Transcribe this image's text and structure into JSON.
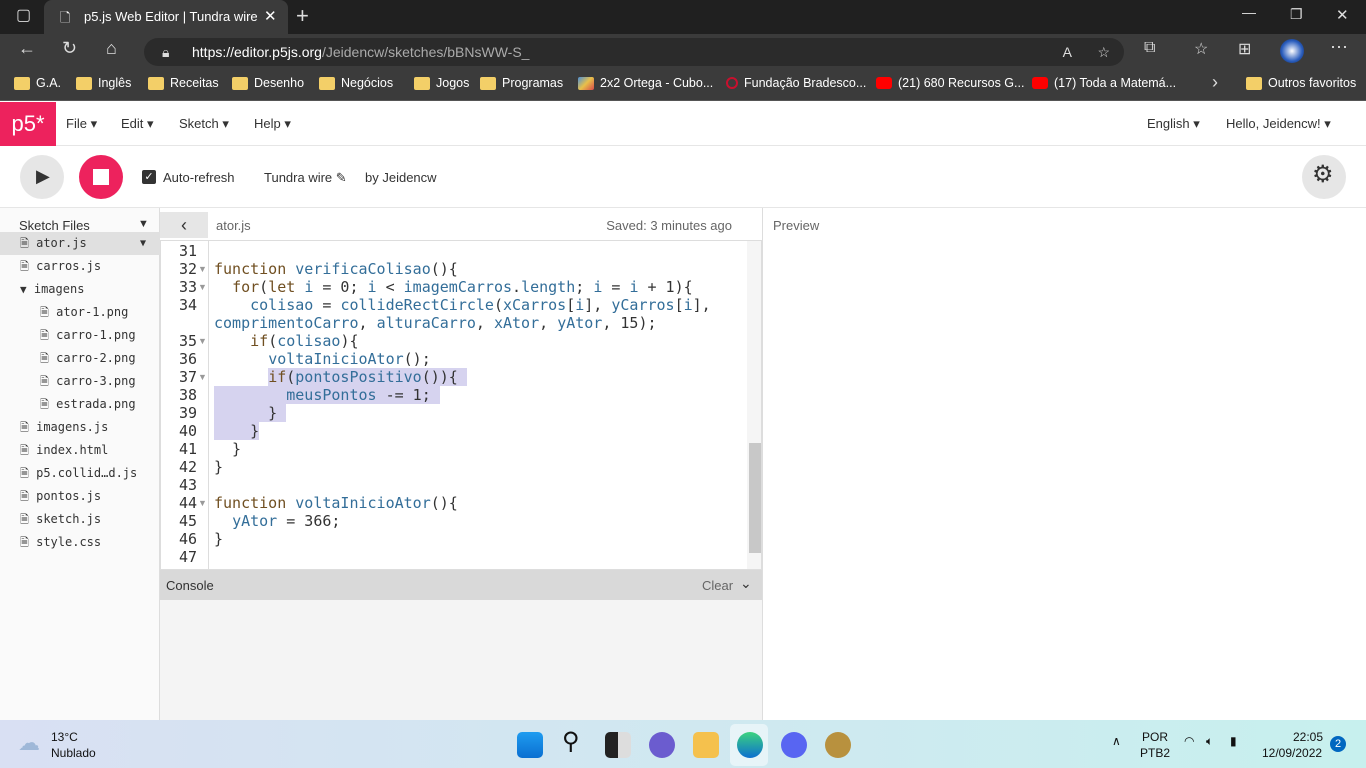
{
  "browser": {
    "tab_title": "p5.js Web Editor | Tundra wire",
    "url_host": "https://editor.p5js.org",
    "url_path": "/Jeidencw/sketches/bBNsWW-S_",
    "bookmarks": [
      {
        "label": "G.A.",
        "icon": "folder"
      },
      {
        "label": "Inglês",
        "icon": "folder"
      },
      {
        "label": "Receitas",
        "icon": "folder"
      },
      {
        "label": "Desenho",
        "icon": "folder"
      },
      {
        "label": "Negócios",
        "icon": "folder"
      },
      {
        "label": "Jogos",
        "icon": "folder"
      },
      {
        "label": "Programas",
        "icon": "folder"
      },
      {
        "label": "2x2 Ortega - Cubo...",
        "icon": "cube"
      },
      {
        "label": "Fundação Bradesco...",
        "icon": "bradesco"
      },
      {
        "label": "(21) 680 Recursos G...",
        "icon": "youtube"
      },
      {
        "label": "(17) Toda a Matemá...",
        "icon": "youtube"
      }
    ],
    "other_favorites": "Outros favoritos"
  },
  "app": {
    "logo": "p5*",
    "menus": [
      "File",
      "Edit",
      "Sketch",
      "Help"
    ],
    "language": "English",
    "user": "Hello, Jeidencw!",
    "auto_refresh_label": "Auto-refresh",
    "auto_refresh": true,
    "sketch_name": "Tundra wire",
    "by": "by Jeidencw",
    "accent": "#ed225d"
  },
  "sidebar": {
    "title": "Sketch Files",
    "files": [
      {
        "name": "ator.js",
        "level": 0,
        "type": "file",
        "selected": true
      },
      {
        "name": "carros.js",
        "level": 0,
        "type": "file"
      },
      {
        "name": "imagens",
        "level": 0,
        "type": "folder"
      },
      {
        "name": "ator-1.png",
        "level": 1,
        "type": "file"
      },
      {
        "name": "carro-1.png",
        "level": 1,
        "type": "file"
      },
      {
        "name": "carro-2.png",
        "level": 1,
        "type": "file"
      },
      {
        "name": "carro-3.png",
        "level": 1,
        "type": "file"
      },
      {
        "name": "estrada.png",
        "level": 1,
        "type": "file"
      },
      {
        "name": "imagens.js",
        "level": 0,
        "type": "file"
      },
      {
        "name": "index.html",
        "level": 0,
        "type": "file"
      },
      {
        "name": "p5.collid…d.js",
        "level": 0,
        "type": "file"
      },
      {
        "name": "pontos.js",
        "level": 0,
        "type": "file"
      },
      {
        "name": "sketch.js",
        "level": 0,
        "type": "file"
      },
      {
        "name": "style.css",
        "level": 0,
        "type": "file"
      }
    ]
  },
  "editor": {
    "filename": "ator.js",
    "saved": "Saved: 3 minutes ago",
    "preview_label": "Preview",
    "lines": [
      {
        "n": "31",
        "t": []
      },
      {
        "n": "32",
        "f": 1,
        "t": [
          [
            "kw",
            "function "
          ],
          [
            "id",
            "verificaColisao"
          ],
          [
            "pl",
            "(){"
          ]
        ]
      },
      {
        "n": "33",
        "f": 1,
        "t": [
          [
            "pl",
            "  "
          ],
          [
            "kw",
            "for"
          ],
          [
            "pl",
            "("
          ],
          [
            "kw",
            "let "
          ],
          [
            "id",
            "i"
          ],
          [
            "pl",
            " = 0; "
          ],
          [
            "id",
            "i"
          ],
          [
            "pl",
            " < "
          ],
          [
            "id",
            "imagemCarros"
          ],
          [
            "pl",
            "."
          ],
          [
            "id",
            "length"
          ],
          [
            "pl",
            "; "
          ],
          [
            "id",
            "i"
          ],
          [
            "pl",
            " = "
          ],
          [
            "id",
            "i"
          ],
          [
            "pl",
            " + 1){"
          ]
        ]
      },
      {
        "n": "34",
        "t": [
          [
            "pl",
            "    "
          ],
          [
            "id",
            "colisao"
          ],
          [
            "pl",
            " = "
          ],
          [
            "id",
            "collideRectCircle"
          ],
          [
            "pl",
            "("
          ],
          [
            "id",
            "xCarros"
          ],
          [
            "pl",
            "["
          ],
          [
            "id",
            "i"
          ],
          [
            "pl",
            "], "
          ],
          [
            "id",
            "yCarros"
          ],
          [
            "pl",
            "["
          ],
          [
            "id",
            "i"
          ],
          [
            "pl",
            "],"
          ]
        ]
      },
      {
        "n": "",
        "t": [
          [
            "id",
            "comprimentoCarro"
          ],
          [
            "pl",
            ", "
          ],
          [
            "id",
            "alturaCarro"
          ],
          [
            "pl",
            ", "
          ],
          [
            "id",
            "xAtor"
          ],
          [
            "pl",
            ", "
          ],
          [
            "id",
            "yAtor"
          ],
          [
            "pl",
            ", 15);"
          ]
        ]
      },
      {
        "n": "35",
        "f": 1,
        "t": [
          [
            "pl",
            "    "
          ],
          [
            "kw",
            "if"
          ],
          [
            "pl",
            "("
          ],
          [
            "id",
            "colisao"
          ],
          [
            "pl",
            "){"
          ]
        ]
      },
      {
        "n": "36",
        "t": [
          [
            "pl",
            "      "
          ],
          [
            "id",
            "voltaInicioAtor"
          ],
          [
            "pl",
            "();"
          ]
        ]
      },
      {
        "n": "37",
        "f": 1,
        "t": [
          [
            "pl",
            "      "
          ],
          [
            "kw sel",
            "if"
          ],
          [
            "pl sel",
            "("
          ],
          [
            "id sel",
            "pontosPositivo"
          ],
          [
            "pl sel",
            "()){ "
          ]
        ]
      },
      {
        "n": "38",
        "t": [
          [
            "pl sel",
            "        "
          ],
          [
            "id sel",
            "meusPontos"
          ],
          [
            "pl sel",
            " -= 1; "
          ]
        ]
      },
      {
        "n": "39",
        "t": [
          [
            "pl sel",
            "      } "
          ]
        ]
      },
      {
        "n": "40",
        "t": [
          [
            "pl sel",
            "    }"
          ]
        ]
      },
      {
        "n": "41",
        "t": [
          [
            "pl",
            "  }"
          ]
        ]
      },
      {
        "n": "42",
        "t": [
          [
            "pl",
            "}"
          ]
        ]
      },
      {
        "n": "43",
        "t": []
      },
      {
        "n": "44",
        "f": 1,
        "t": [
          [
            "kw",
            "function "
          ],
          [
            "id",
            "voltaInicioAtor"
          ],
          [
            "pl",
            "(){"
          ]
        ]
      },
      {
        "n": "45",
        "t": [
          [
            "pl",
            "  "
          ],
          [
            "id",
            "yAtor"
          ],
          [
            "pl",
            " = 366;"
          ]
        ]
      },
      {
        "n": "46",
        "t": [
          [
            "pl",
            "}"
          ]
        ]
      },
      {
        "n": "47",
        "t": []
      }
    ]
  },
  "console": {
    "label": "Console",
    "clear": "Clear"
  },
  "taskbar": {
    "temp": "13°C",
    "weather": "Nublado",
    "lang1": "POR",
    "lang2": "PTB2",
    "time": "22:05",
    "date": "12/09/2022",
    "notifications": "2"
  }
}
